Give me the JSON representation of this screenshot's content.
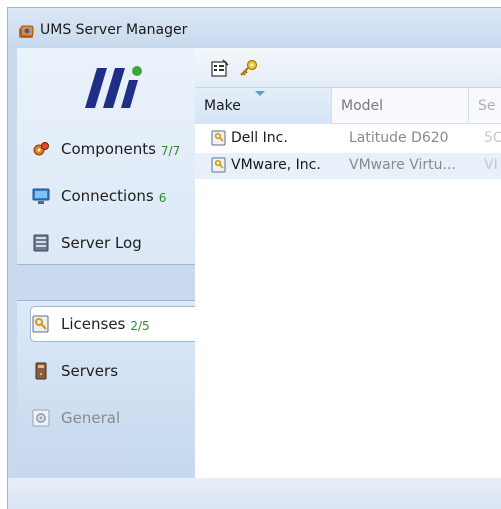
{
  "window": {
    "title": "UMS Server Manager",
    "icon": "ums-app-icon"
  },
  "sidebar": {
    "logo": "igel-logo",
    "items": [
      {
        "label": "Components",
        "count": "7/7",
        "icon": "components-icon"
      },
      {
        "label": "Connections",
        "count": "6",
        "icon": "connections-icon"
      },
      {
        "label": "Server Log",
        "count": "",
        "icon": "server-log-icon"
      },
      {
        "label": "Licenses",
        "count": "2/5",
        "icon": "licenses-icon",
        "selected": true
      },
      {
        "label": "Servers",
        "count": "",
        "icon": "servers-icon"
      },
      {
        "label": "General",
        "count": "",
        "icon": "general-icon",
        "disabled": true
      }
    ]
  },
  "toolbar": {
    "buttons": [
      {
        "icon": "properties-icon"
      },
      {
        "icon": "key-icon"
      }
    ]
  },
  "table": {
    "columns": [
      "Make",
      "Model",
      "Se"
    ],
    "sorted_column": "Make",
    "rows": [
      {
        "make": "Dell Inc.",
        "model": "Latitude D620",
        "extra": "5C"
      },
      {
        "make": "VMware, Inc.",
        "model": "VMware Virtu...",
        "extra": "VI"
      }
    ]
  },
  "colors": {
    "accent": "#5a9bd6",
    "count_green": "#2e8b2e",
    "sidebar_border": "#9fb7d2"
  }
}
